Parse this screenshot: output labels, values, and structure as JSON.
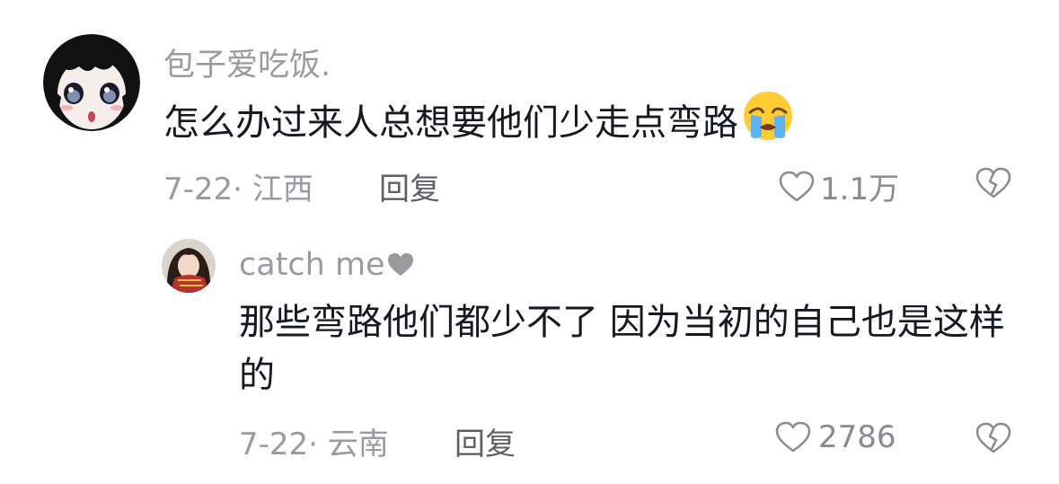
{
  "comments": [
    {
      "username": "包子爱吃饭.",
      "text": "怎么办过来人总想要他们少走点弯路",
      "text_emoji": "crying-face-emoji",
      "date": "7-22",
      "location": "江西",
      "meta_text": "7-22· 江西",
      "reply_label": "回复",
      "likes": "1.1万",
      "avatar": "anime-girl-avatar"
    },
    {
      "username": "catch me",
      "username_icon": "heart-icon",
      "text": "那些弯路他们都少不了 因为当初的自己也是这样的",
      "date": "7-22",
      "location": "云南",
      "meta_text": "7-22· 云南",
      "reply_label": "回复",
      "likes": "2786",
      "avatar": "girl-photo-avatar"
    }
  ],
  "colors": {
    "primary_text": "#161823",
    "secondary_text": "#9a9aa0",
    "reply_text": "#5f5f66"
  }
}
